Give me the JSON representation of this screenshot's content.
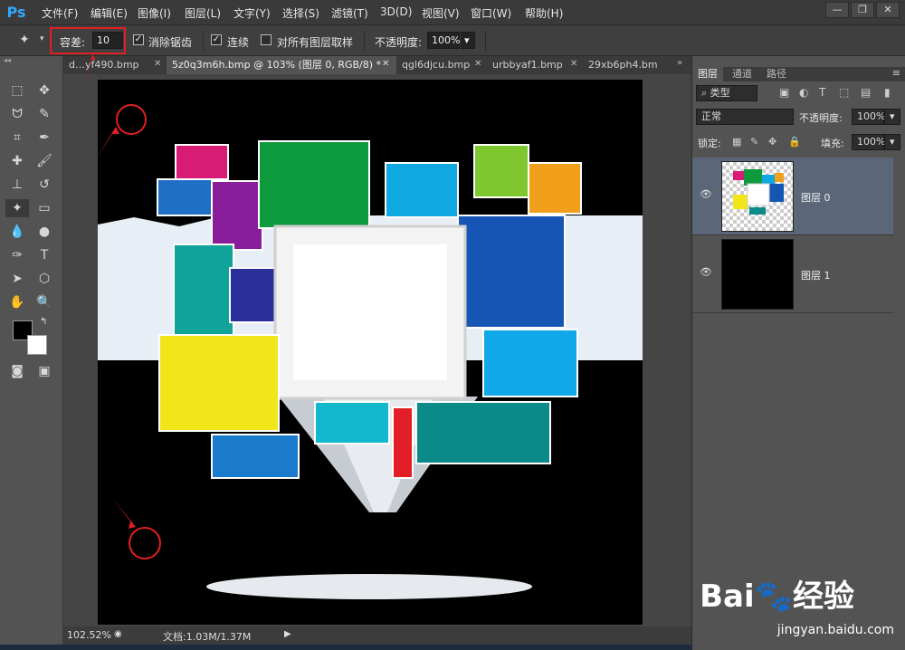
{
  "app": {
    "logo": "Ps"
  },
  "menu": [
    "文件(F)",
    "编辑(E)",
    "图像(I)",
    "图层(L)",
    "文字(Y)",
    "选择(S)",
    "滤镜(T)",
    "3D(D)",
    "视图(V)",
    "窗口(W)",
    "帮助(H)"
  ],
  "window_buttons": [
    "—",
    "❐",
    "✕"
  ],
  "options": {
    "tolerance_label": "容差:",
    "tolerance_value": "10",
    "antialias_label": "消除锯齿",
    "antialias_checked": true,
    "contiguous_label": "连续",
    "contiguous_checked": true,
    "sample_all_label": "对所有图层取样",
    "sample_all_checked": false,
    "opacity_label": "不透明度:",
    "opacity_value": "100%"
  },
  "tabs": [
    {
      "label": "d…yf490.bmp",
      "active": false
    },
    {
      "label": "5z0q3m6h.bmp @ 103% (图层 0, RGB/8) *",
      "active": true
    },
    {
      "label": "qgl6djcu.bmp",
      "active": false
    },
    {
      "label": "urbbyaf1.bmp",
      "active": false
    },
    {
      "label": "29xb6ph4.bm",
      "active": false
    }
  ],
  "status": {
    "zoom": "102.52%",
    "doc_label": "文档:1.03M/1.37M"
  },
  "layers_panel": {
    "tabs": [
      "图层",
      "通道",
      "路径"
    ],
    "filter_label": "类型",
    "blend_mode": "正常",
    "opacity_label": "不透明度:",
    "opacity_value": "100%",
    "lock_label": "锁定:",
    "fill_label": "填充:",
    "fill_value": "100%",
    "layers": [
      {
        "name": "图层 0",
        "selected": true
      },
      {
        "name": "图层 1",
        "selected": false
      }
    ]
  },
  "watermark": {
    "brand": "Bai🐾经验",
    "url": "jingyan.baidu.com"
  },
  "colors": {
    "accent_red": "#e02020",
    "selection": "#5b6778",
    "ps_blue": "#31a8ff"
  }
}
